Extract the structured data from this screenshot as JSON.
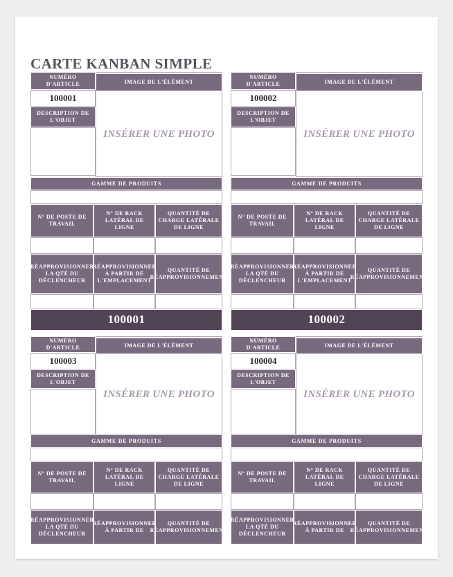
{
  "document": {
    "title": "CARTE KANBAN SIMPLE"
  },
  "labels": {
    "item_number": "NUMÉRO D'ARTICLE",
    "item_image": "IMAGE DE L'ÉLÉMENT",
    "object_description": "DESCRIPTION DE L'OBJET",
    "photo_placeholder": "INSÉRER UNE PHOTO",
    "product_range": "GAMME DE PRODUITS",
    "workstation_number": "N° DE POSTE DE TRAVAIL",
    "line_side_rack_number": "N° DE RACK LATÉRAL DE LIGNE",
    "line_side_load_quantity": "QUANTITÉ DE CHARGE LATÉRALE DE LIGNE",
    "trigger_qty_replenish": "RÉAPPROVISIONNER LA QTÉ DU DÉCLENCHEUR",
    "replenish_from_location": "RÉAPPROVISIONNER À PARTIR DE L'EMPLACEMENT",
    "replenish_from_short": "RÉAPPROVISIONNER À PARTIR DE",
    "replenishment_quantity": "QUANTITÉ DE RÉAPPROVISIONNEMENT"
  },
  "colors": {
    "header_purple": "#786a7e",
    "footer_dark": "#514455",
    "placeholder_text": "#a79aad",
    "cell_border": "#b2a7b6",
    "page_background": "#ffffff",
    "canvas_background": "#efeff0"
  },
  "cards": [
    {
      "id": "card-100001",
      "item_number": "100001",
      "footer_number": "100001",
      "replenish_from_label": "RÉAPPROVISIONNER À PARTIR DE L'EMPLACEMENT",
      "has_footer": true
    },
    {
      "id": "card-100002",
      "item_number": "100002",
      "footer_number": "100002",
      "replenish_from_label": "RÉAPPROVISIONNER À PARTIR DE L'EMPLACEMENT",
      "has_footer": true
    },
    {
      "id": "card-100003",
      "item_number": "100003",
      "footer_number": "",
      "replenish_from_label": "RÉAPPROVISIONNER À PARTIR DE",
      "has_footer": false
    },
    {
      "id": "card-100004",
      "item_number": "100004",
      "footer_number": "",
      "replenish_from_label": "RÉAPPROVISIONNER À PARTIR DE",
      "has_footer": false
    }
  ]
}
